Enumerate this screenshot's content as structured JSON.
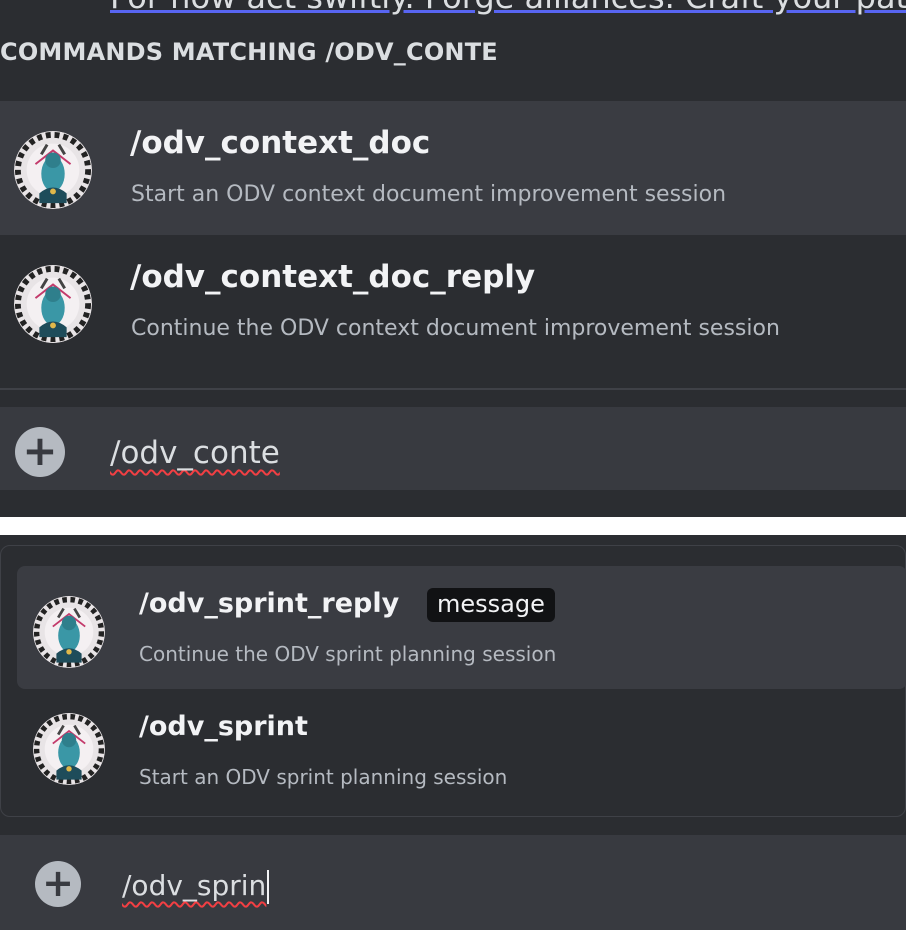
{
  "top_panel": {
    "cutoff_text": "For now act swiftly. Forge alliances. Craft your path",
    "header": "COMMANDS MATCHING /ODV_CONTE",
    "commands": [
      {
        "name": "/odv_context_doc",
        "description": "Start an ODV context document improvement session",
        "icon": "bot-avatar-icon"
      },
      {
        "name": "/odv_context_doc_reply",
        "description": "Continue the ODV context document improvement session",
        "icon": "bot-avatar-icon"
      }
    ],
    "input": {
      "icon": "plus-circle-icon",
      "value": "/odv_conte"
    }
  },
  "bottom_panel": {
    "commands": [
      {
        "name": "/odv_sprint_reply",
        "badge": "message",
        "description": "Continue the ODV sprint planning session",
        "icon": "bot-avatar-icon"
      },
      {
        "name": "/odv_sprint",
        "description": "Start an ODV sprint planning session",
        "icon": "bot-avatar-icon"
      }
    ],
    "input": {
      "icon": "plus-circle-icon",
      "value": "/odv_sprin"
    }
  },
  "colors": {
    "panel_bg": "#2b2d31",
    "selected_bg": "#3a3c42",
    "input_bg": "#383a40",
    "text_primary": "#f2f3f5",
    "text_muted": "#b5bac1",
    "spellcheck": "#f23f43"
  }
}
